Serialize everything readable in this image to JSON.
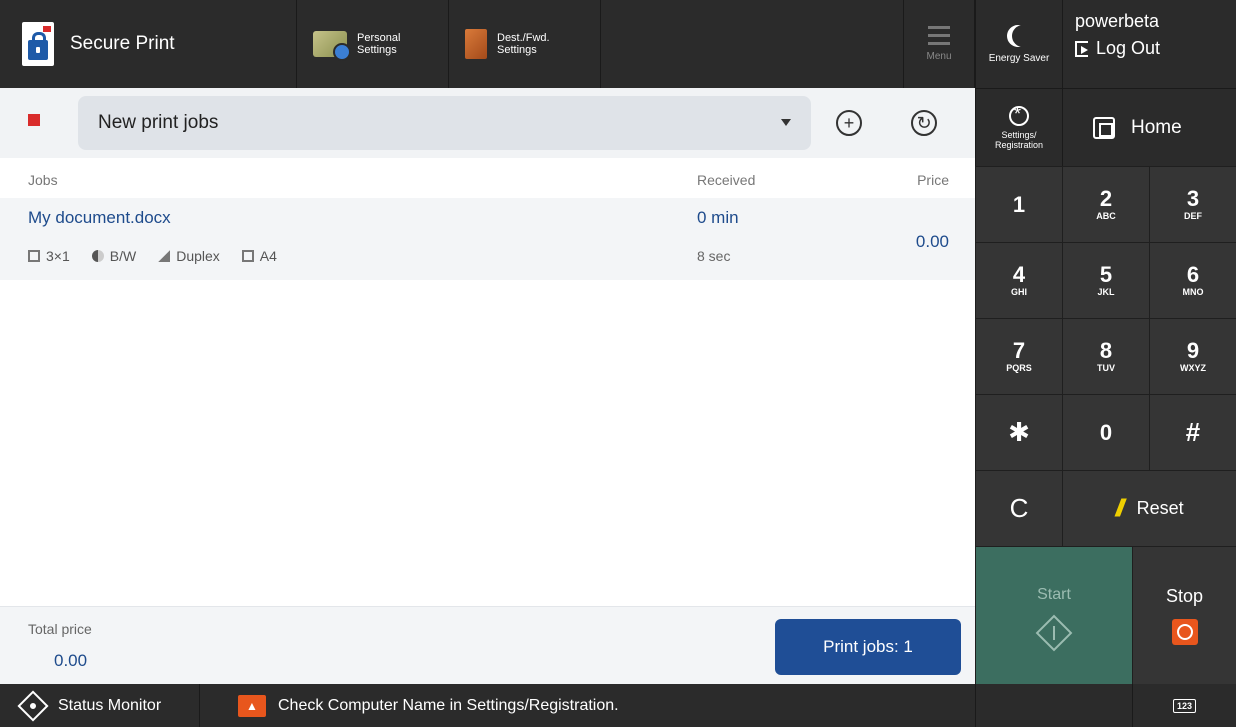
{
  "topbar": {
    "app_title": "Secure Print",
    "shortcuts": [
      {
        "label_line1": "Personal",
        "label_line2": "Settings",
        "icon": "personal-settings-icon"
      },
      {
        "label_line1": "Dest./Fwd.",
        "label_line2": "Settings",
        "icon": "dest-fwd-settings-icon"
      }
    ],
    "menu_label": "Menu",
    "energy_saver_label": "Energy Saver",
    "user_name": "powerbeta",
    "logout_label": "Log Out",
    "settings_line1": "Settings/",
    "settings_line2": "Registration",
    "home_label": "Home"
  },
  "filter": {
    "selected": "New print jobs",
    "add_symbol": "+",
    "refresh_symbol": "↻"
  },
  "table": {
    "headers": {
      "jobs": "Jobs",
      "received": "Received",
      "price": "Price"
    },
    "rows": [
      {
        "name": "My document.docx",
        "copies": "3×1",
        "color": "B/W",
        "sides": "Duplex",
        "paper": "A4",
        "received_main": "0 min",
        "received_sub": "8 sec",
        "price": "0.00"
      }
    ]
  },
  "footer": {
    "total_label": "Total price",
    "total_value": "0.00",
    "print_button": "Print jobs: 1"
  },
  "keypad": {
    "keys": [
      {
        "num": "1",
        "sub": ""
      },
      {
        "num": "2",
        "sub": "ABC"
      },
      {
        "num": "3",
        "sub": "DEF"
      },
      {
        "num": "4",
        "sub": "GHI"
      },
      {
        "num": "5",
        "sub": "JKL"
      },
      {
        "num": "6",
        "sub": "MNO"
      },
      {
        "num": "7",
        "sub": "PQRS"
      },
      {
        "num": "8",
        "sub": "TUV"
      },
      {
        "num": "9",
        "sub": "WXYZ"
      },
      {
        "num": "✱",
        "sub": ""
      },
      {
        "num": "0",
        "sub": ""
      },
      {
        "num": "#",
        "sub": ""
      }
    ],
    "clear_label": "C",
    "reset_label": "Reset",
    "start_label": "Start",
    "stop_label": "Stop"
  },
  "statusbar": {
    "status_monitor_label": "Status Monitor",
    "message": "Check Computer Name in Settings/Registration.",
    "keyboard_label": "123"
  },
  "colors": {
    "dark_bg": "#2b2b2b",
    "accent_blue": "#1f4e96",
    "start_green": "#3c6e60",
    "stop_orange": "#e8561d"
  }
}
